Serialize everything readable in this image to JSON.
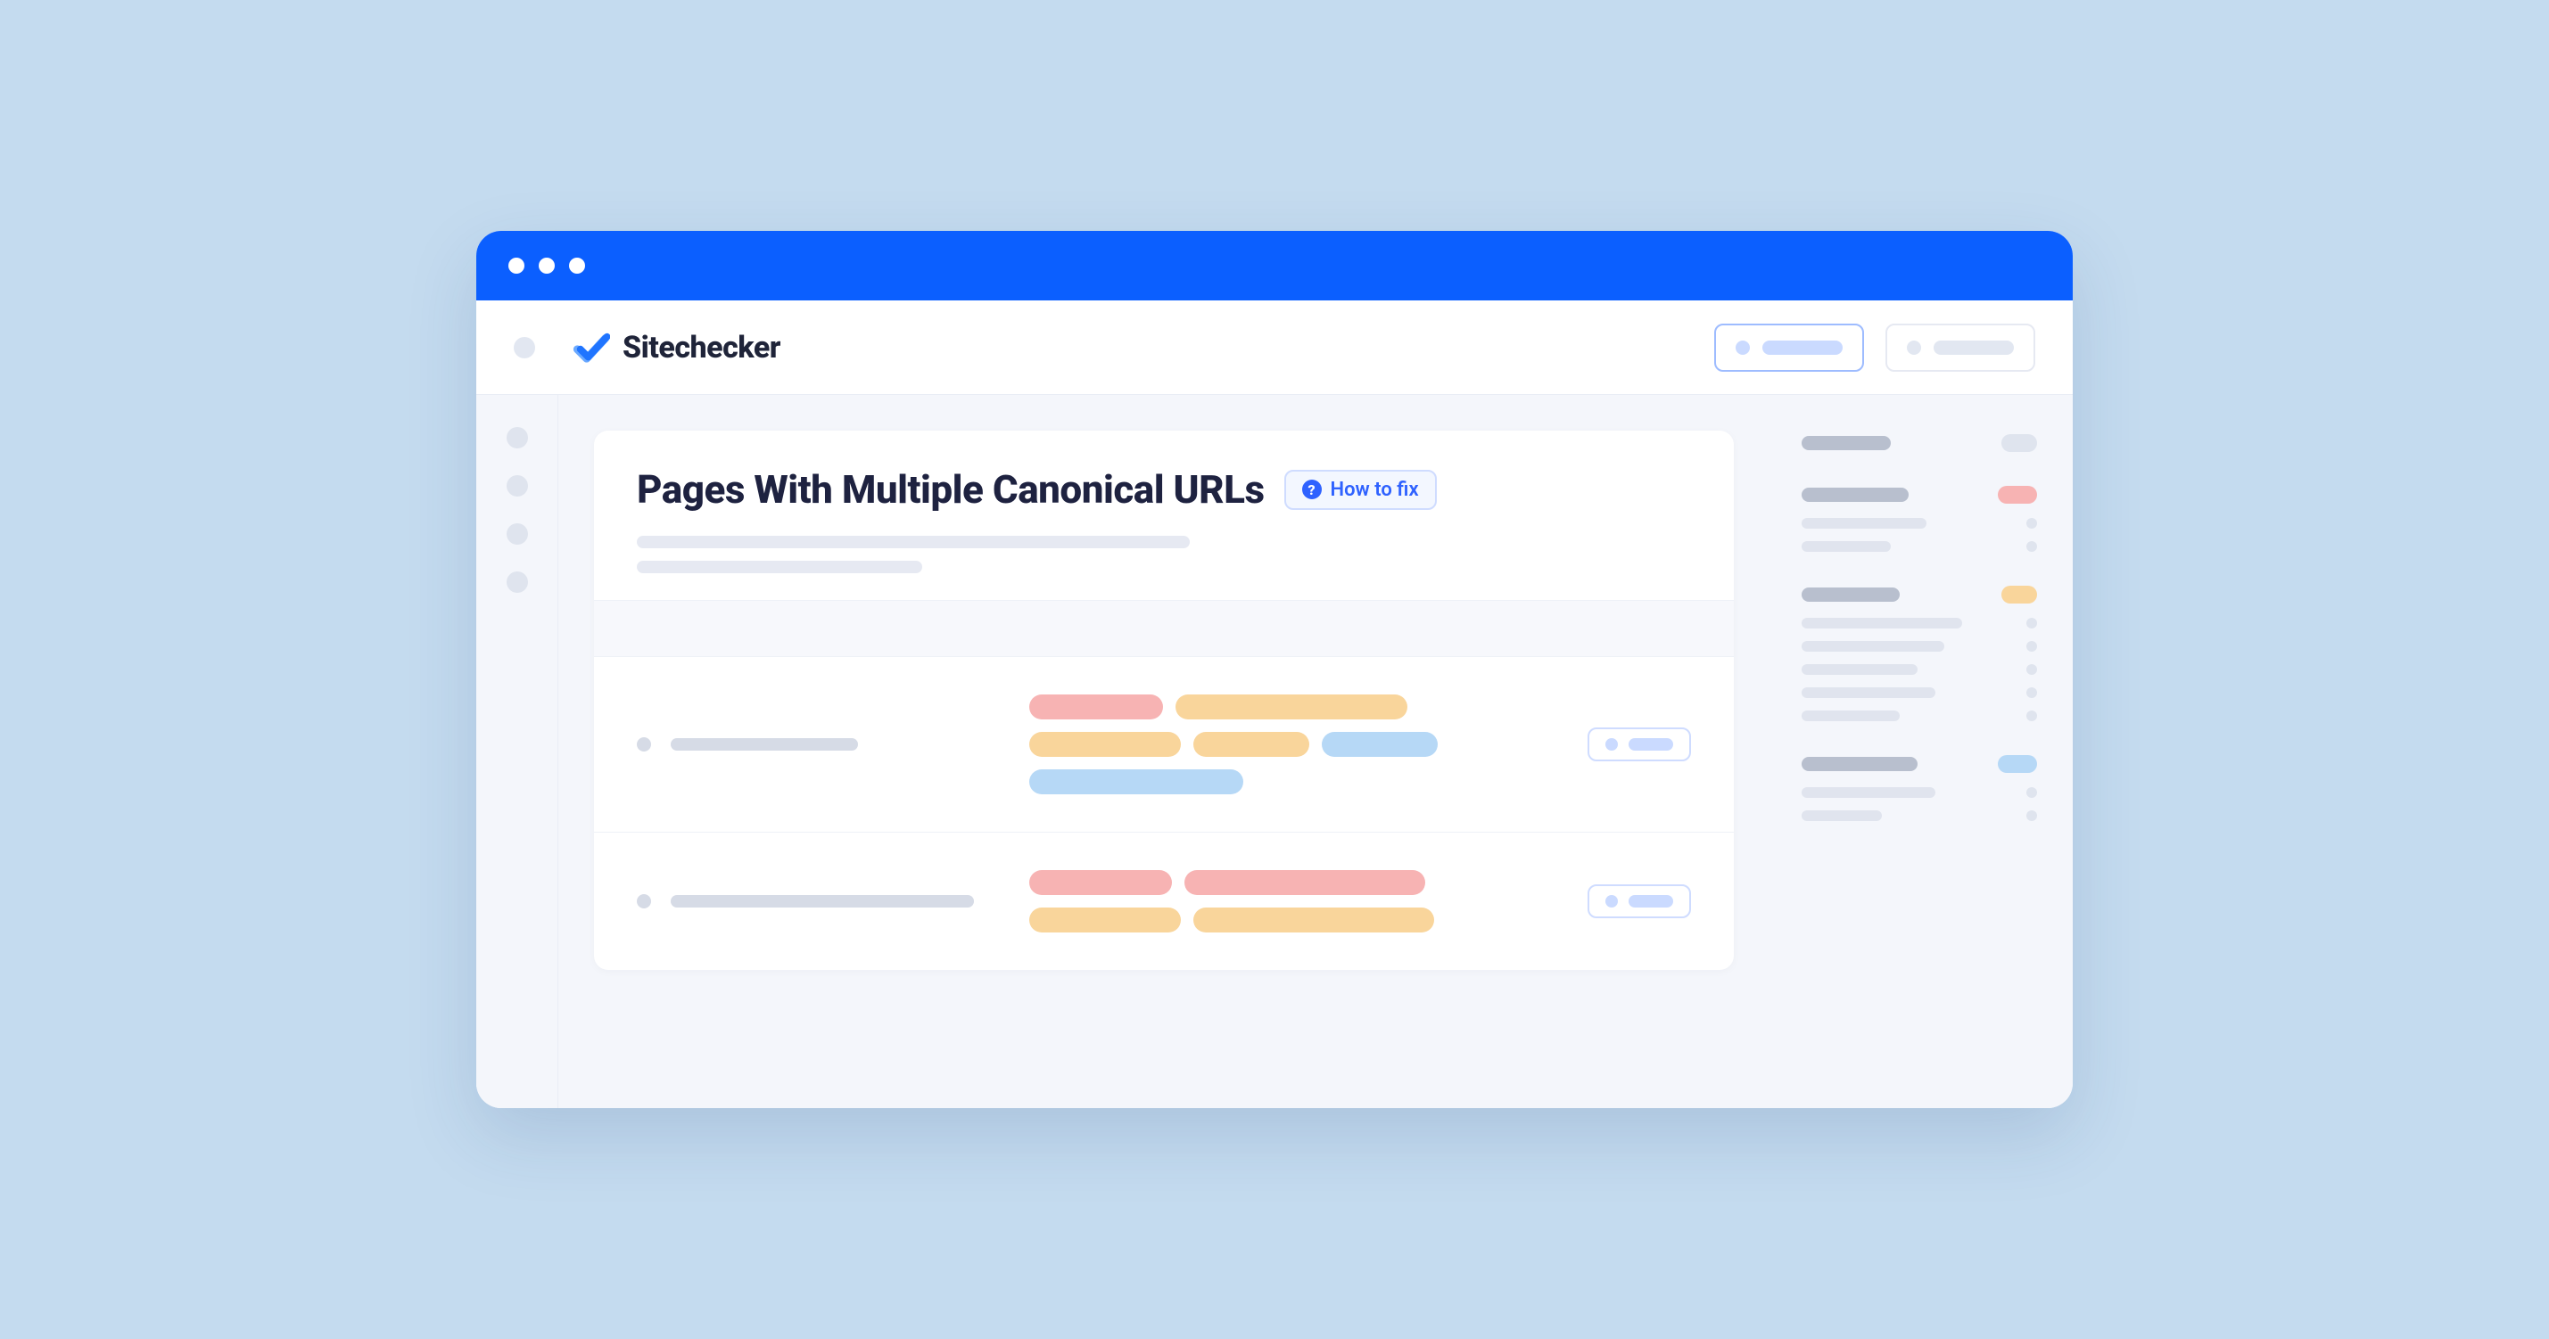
{
  "brand": {
    "name": "Sitechecker"
  },
  "page": {
    "title": "Pages With Multiple Canonical URLs",
    "how_to_fix_label": "How to fix"
  },
  "colors": {
    "accent": "#0b5fff",
    "tag_red": "#f7b3b3",
    "tag_orange": "#f9d59b",
    "tag_blue": "#b6d8f6"
  }
}
